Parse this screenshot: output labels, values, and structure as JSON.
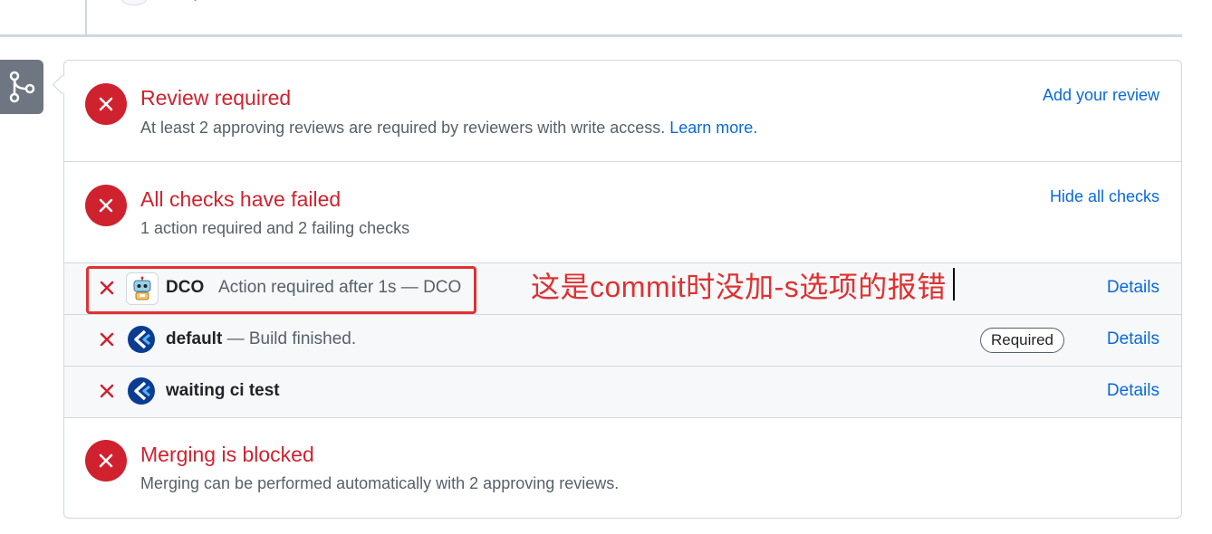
{
  "review": {
    "title": "Review required",
    "desc": "At least 2 approving reviews are required by reviewers with write access.",
    "learn_more": "Learn more.",
    "action": "Add your review"
  },
  "checks": {
    "title": "All checks have failed",
    "desc": "1 action required and 2 failing checks",
    "action": "Hide all checks",
    "rows": [
      {
        "name": "DCO",
        "status": "Action required after 1s — DCO",
        "details": "Details",
        "icon": "robot-bot-icon"
      },
      {
        "name": "default",
        "status": "— Build finished.",
        "badge": "Required",
        "details": "Details",
        "icon": "ci-logo-icon"
      },
      {
        "name": "waiting ci test",
        "status": "",
        "details": "Details",
        "icon": "ci-logo-icon"
      }
    ]
  },
  "merge": {
    "title": "Merging is blocked",
    "desc": "Merging can be performed automatically with 2 approving reviews."
  },
  "annotation": {
    "text": "这是commit时没加-s选项的报错"
  },
  "colors": {
    "error": "#cf222e",
    "link": "#0969da",
    "annotation": "#e03131",
    "border": "#d0d7de"
  }
}
